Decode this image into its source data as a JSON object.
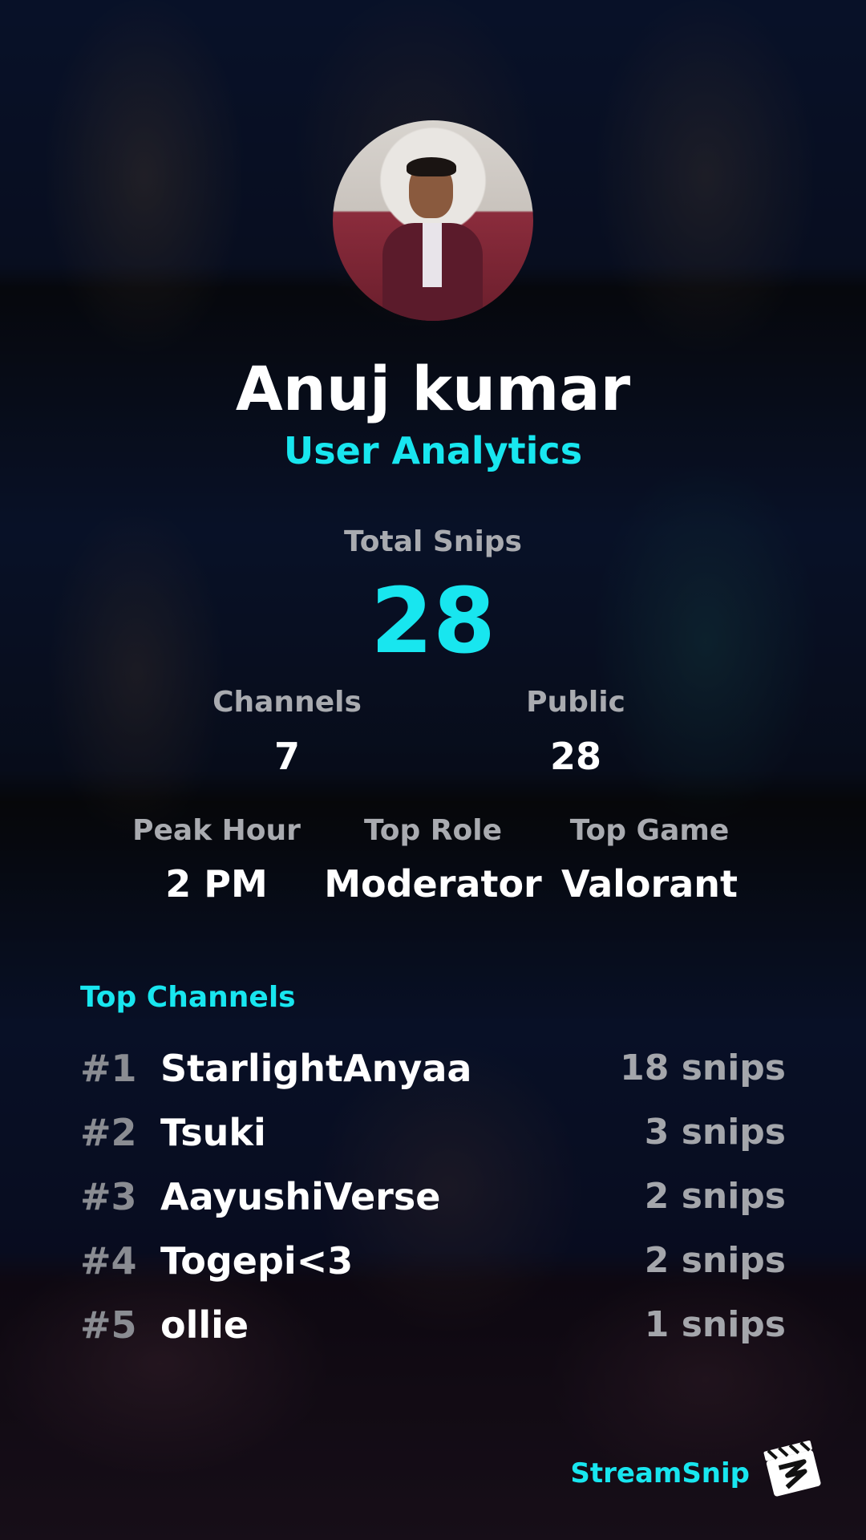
{
  "profile": {
    "name": "Anuj kumar",
    "subtitle": "User Analytics"
  },
  "totals": {
    "total_label": "Total Snips",
    "total_value": "28"
  },
  "stats_row1": [
    {
      "label": "Channels",
      "value": "7"
    },
    {
      "label": "Public",
      "value": "28"
    }
  ],
  "stats_row2": [
    {
      "label": "Peak Hour",
      "value": "2 PM"
    },
    {
      "label": "Top Role",
      "value": "Moderator"
    },
    {
      "label": "Top Game",
      "value": "Valorant"
    }
  ],
  "top_channels": {
    "title": "Top Channels",
    "items": [
      {
        "rank": "#1",
        "name": "StarlightAnyaa",
        "count": "18 snips"
      },
      {
        "rank": "#2",
        "name": "Tsuki",
        "count": "3 snips"
      },
      {
        "rank": "#3",
        "name": "AayushiVerse",
        "count": "2 snips"
      },
      {
        "rank": "#4",
        "name": "Togepi<3",
        "count": "2 snips"
      },
      {
        "rank": "#5",
        "name": "ollie",
        "count": "1 snips"
      }
    ]
  },
  "brand": {
    "name": "StreamSnip",
    "logo_icon": "clapperboard-icon"
  },
  "colors": {
    "accent": "#18e6ef",
    "label_gray": "#a9abb0",
    "rank_gray": "#8a8c92"
  }
}
